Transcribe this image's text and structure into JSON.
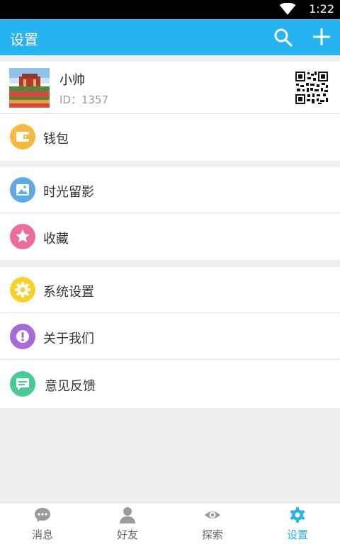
{
  "status_bar": {
    "time": "1:22"
  },
  "app_bar": {
    "title": "设置"
  },
  "profile": {
    "name": "小帅",
    "id_text": "ID：1357"
  },
  "menu": {
    "wallet": "钱包",
    "moments": "时光留影",
    "favorites": "收藏",
    "system_settings": "系统设置",
    "about_us": "关于我们",
    "feedback": "意见反馈"
  },
  "icon_colors": {
    "wallet": "#f6b93b",
    "moments": "#5fa9e8",
    "favorites": "#ee6c9a",
    "system_settings": "#f8d126",
    "about_us": "#a96ad8",
    "feedback": "#45cb93"
  },
  "bottom_nav": {
    "items": [
      {
        "label": "消息",
        "icon": "chat-icon",
        "active": false
      },
      {
        "label": "好友",
        "icon": "person-icon",
        "active": false
      },
      {
        "label": "探索",
        "icon": "eye-icon",
        "active": false
      },
      {
        "label": "设置",
        "icon": "gear-icon",
        "active": true
      }
    ]
  },
  "accent_color": "#26b3f2"
}
